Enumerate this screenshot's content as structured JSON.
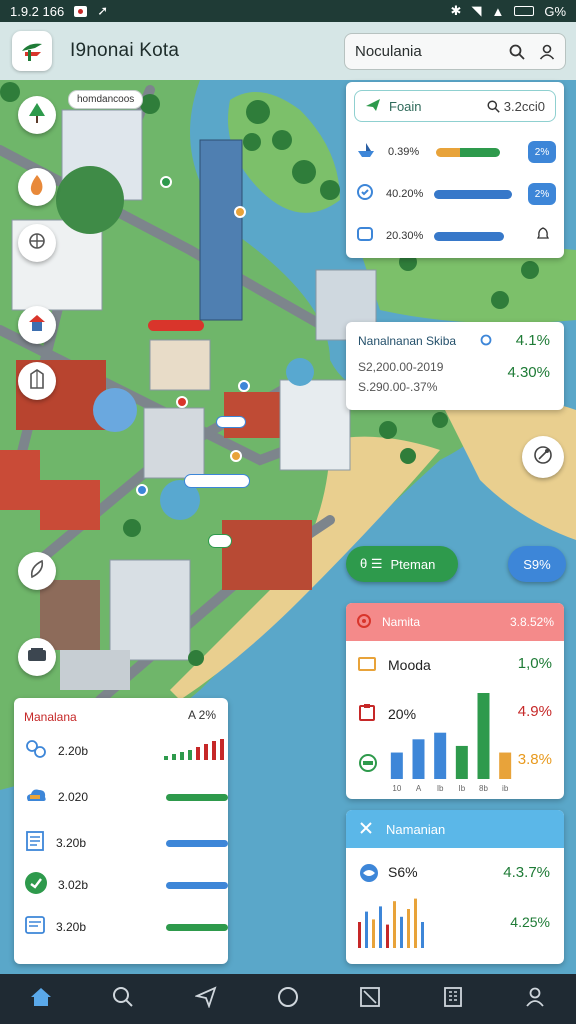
{
  "status_bar": {
    "time": "1.9.2 166",
    "battery": "G%"
  },
  "app": {
    "title": "I9nonai Kota"
  },
  "search": {
    "value": "Noculania"
  },
  "map_labels": {
    "top_tag": "homdancoos"
  },
  "stats_card": {
    "title": "Foain",
    "summary": "3.2cci0",
    "rows": [
      {
        "value": "0.39%",
        "icon": "ship-icon",
        "action": "2%",
        "color_a": "#e8a33a",
        "color_b": "#2e9a4c"
      },
      {
        "value": "40.20%",
        "icon": "shield-icon",
        "action": "2%",
        "color_a": "#3778c9",
        "color_b": "#3778c9"
      },
      {
        "value": "20.30%",
        "icon": "screen-icon",
        "action": "",
        "color_a": "#3778c9",
        "color_b": "#3778c9"
      }
    ]
  },
  "info_card": {
    "title": "Nanalnanan Skiba",
    "percent": "4.1%",
    "line1": "S2,200.00-2019",
    "line2": "S.290.00-.37%",
    "percent2": "4.30%"
  },
  "chips": {
    "pill_label": "Pteman",
    "pill_prefix": "θ ☰",
    "blue_chip": "S9%"
  },
  "chart_card": {
    "title": "Namita",
    "title_pct": "3.8.52%",
    "items": [
      {
        "label": "Mooda",
        "value": "1,0%",
        "color": "#1e7b36",
        "icon": "folder-icon"
      },
      {
        "label": "20%",
        "value": "4.9%",
        "color": "#c62828",
        "icon": "clipboard-icon"
      },
      {
        "label": "",
        "value": "3.8%",
        "color": "#e89a1e",
        "icon": "badge-icon"
      }
    ]
  },
  "chart_data": {
    "type": "bar",
    "categories": [
      "10",
      "A",
      "Ib",
      "Ib",
      "8b",
      "ib"
    ],
    "values": [
      2,
      3,
      3.5,
      2.5,
      6.5,
      2
    ],
    "colors": [
      "#3d86d8",
      "#3d86d8",
      "#3d86d8",
      "#2e9a4c",
      "#2e9a4c",
      "#e8a33a"
    ]
  },
  "detail_card": {
    "title": "Namanian",
    "line_label": "S6%",
    "line_value": "4.3.7%",
    "bottom_value": "4.25%",
    "mini_bars": [
      0.5,
      0.7,
      0.55,
      0.8,
      0.45,
      0.9,
      0.6,
      0.75,
      0.95,
      0.5
    ],
    "mini_colors": [
      "#c62828",
      "#3d86d8",
      "#e8a33a",
      "#3d86d8",
      "#c62828",
      "#e8a33a",
      "#3d86d8",
      "#e8a33a",
      "#e8a33a",
      "#3d86d8"
    ]
  },
  "list_card": {
    "title": "Manalana",
    "percent": "A 2%",
    "rows": [
      {
        "value": "2.20b",
        "icon": "network-icon",
        "color": "#2e9a4c"
      },
      {
        "value": "2.020",
        "icon": "cloud-icon",
        "color": "#2e9a4c"
      },
      {
        "value": "3.20b",
        "icon": "document-icon",
        "color": "#3d86d8"
      },
      {
        "value": "3.02b",
        "icon": "check-icon",
        "color": "#3d86d8"
      },
      {
        "value": "3.20b",
        "icon": "card-icon",
        "color": "#2e9a4c"
      }
    ]
  },
  "bottom_nav": {
    "items": [
      "home-icon",
      "search-icon",
      "send-icon",
      "circle-icon",
      "map-icon",
      "building-icon",
      "profile-icon"
    ]
  }
}
